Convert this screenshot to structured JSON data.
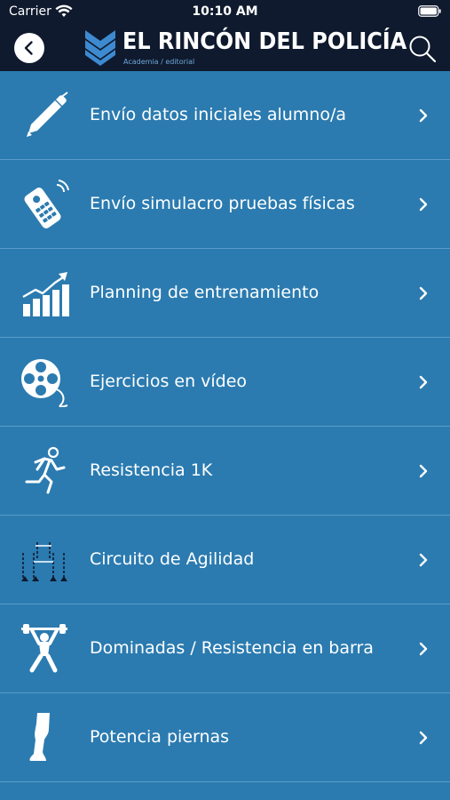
{
  "status_bar": {
    "carrier": "Carrier",
    "time": "10:10 AM"
  },
  "header": {
    "title": "EL RINCÓN DEL POLICÍA",
    "subtitle": "Academia / editorial"
  },
  "menu": {
    "items": [
      {
        "label": "Envío datos iniciales alumno/a",
        "icon": "pen-icon"
      },
      {
        "label": "Envío simulacro pruebas físicas",
        "icon": "remote-control-icon"
      },
      {
        "label": "Planning de entrenamiento",
        "icon": "growth-chart-icon"
      },
      {
        "label": "Ejercicios en vídeo",
        "icon": "film-reel-icon"
      },
      {
        "label": "Resistencia 1K",
        "icon": "runner-icon"
      },
      {
        "label": "Circuito de Agilidad",
        "icon": "agility-hurdles-icon"
      },
      {
        "label": "Dominadas / Resistencia en barra",
        "icon": "weightlifter-icon"
      },
      {
        "label": "Potencia piernas",
        "icon": "leg-icon"
      }
    ]
  },
  "colors": {
    "header_bg": "#0f1a2e",
    "row_bg": "#2b7bb0",
    "divider": "#5a9ccb",
    "text": "#ffffff",
    "logo_accent": "#3d8ad0"
  }
}
